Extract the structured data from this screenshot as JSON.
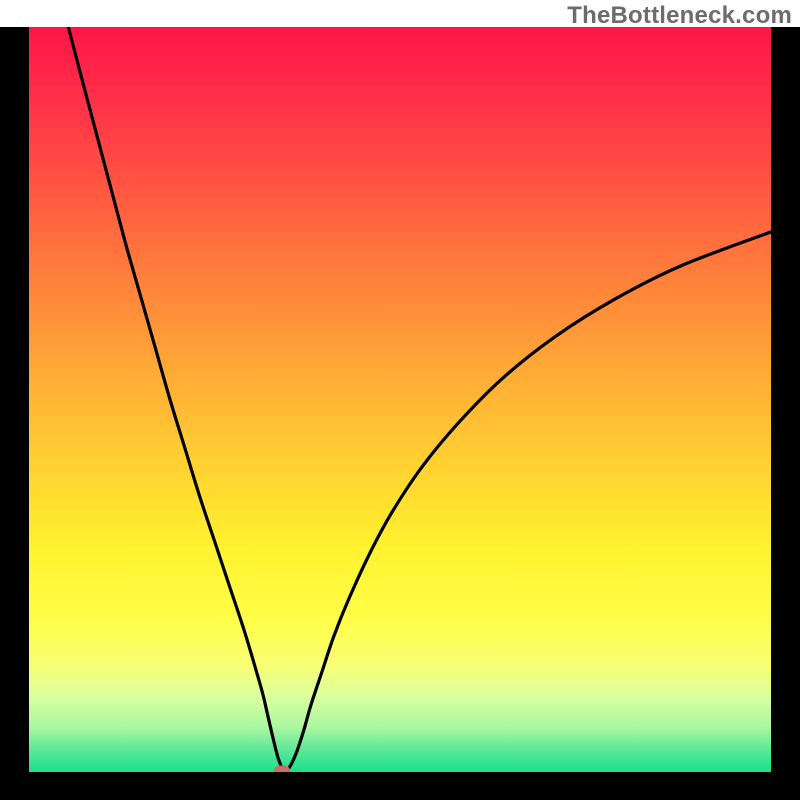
{
  "watermark": "TheBottleneck.com",
  "chart_data": {
    "type": "line",
    "title": "",
    "xlabel": "",
    "ylabel": "",
    "x_range": [
      0,
      100
    ],
    "y_range": [
      0,
      100
    ],
    "series": [
      {
        "name": "bottleneck-curve",
        "x": [
          5.3,
          7,
          9,
          11,
          13,
          15,
          17,
          19,
          21,
          23,
          25,
          27,
          29,
          30.5,
          31.5,
          32.2,
          32.9,
          33.6,
          34.3,
          35.0,
          36,
          37,
          38,
          39.5,
          41,
          43,
          46,
          49,
          53,
          58,
          64,
          71,
          79,
          88,
          100
        ],
        "y": [
          100,
          93.5,
          86,
          78.5,
          71,
          64,
          57,
          50,
          43.5,
          37,
          31,
          25,
          19,
          14,
          10.5,
          7.5,
          4.5,
          1.8,
          0.3,
          0.5,
          2.5,
          5.5,
          9,
          13.5,
          18,
          23,
          29.5,
          35,
          41,
          47,
          53,
          58.5,
          63.5,
          68,
          72.5
        ]
      }
    ],
    "marker": {
      "x": 34.1,
      "y": 0.2
    },
    "background_gradient": [
      "#ff1646",
      "#ffa636",
      "#fff22e",
      "#17e08c"
    ],
    "grid": false,
    "legend": false
  }
}
